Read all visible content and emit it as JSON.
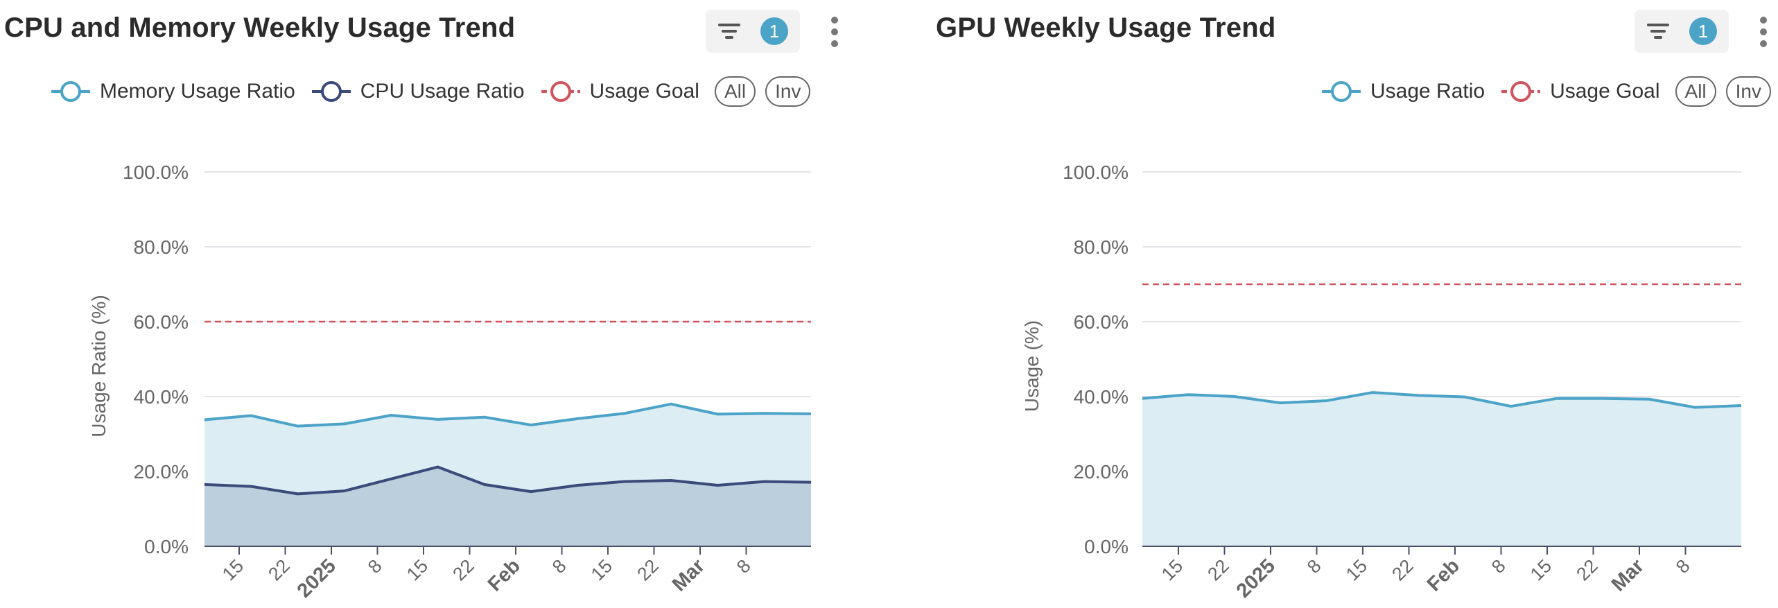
{
  "panels": [
    {
      "title": "CPU and Memory Weekly Usage Trend",
      "filter_badge": "1",
      "legend": [
        {
          "label": "Memory Usage Ratio",
          "color": "#4ba3c7",
          "icon": "circle-line-marker"
        },
        {
          "label": "CPU Usage Ratio",
          "color": "#3a4a7a",
          "icon": "circle-line-marker"
        },
        {
          "label": "Usage Goal",
          "color": "#d0545e",
          "icon": "circle-dashed-line-marker"
        }
      ],
      "buttons": {
        "all": "All",
        "inv": "Inv"
      }
    },
    {
      "title": "GPU Weekly Usage Trend",
      "filter_badge": "1",
      "legend": [
        {
          "label": "Usage Ratio",
          "color": "#4ba3c7",
          "icon": "circle-line-marker"
        },
        {
          "label": "Usage Goal",
          "color": "#d0545e",
          "icon": "circle-dashed-line-marker"
        }
      ],
      "buttons": {
        "all": "All",
        "inv": "Inv"
      }
    }
  ],
  "chart_data": [
    {
      "type": "area",
      "ylabel": "Usage Ratio (%)",
      "ylim": [
        0,
        100
      ],
      "yticks": [
        "0.0%",
        "20.0%",
        "40.0%",
        "60.0%",
        "80.0%",
        "100.0%"
      ],
      "xticks": [
        {
          "label": "15",
          "bold": false
        },
        {
          "label": "22",
          "bold": false
        },
        {
          "label": "2025",
          "bold": true
        },
        {
          "label": "8",
          "bold": false
        },
        {
          "label": "15",
          "bold": false
        },
        {
          "label": "22",
          "bold": false
        },
        {
          "label": "Feb",
          "bold": true
        },
        {
          "label": "8",
          "bold": false
        },
        {
          "label": "15",
          "bold": false
        },
        {
          "label": "22",
          "bold": false
        },
        {
          "label": "Mar",
          "bold": true
        },
        {
          "label": "8",
          "bold": false
        }
      ],
      "x": [
        "2024-12-10",
        "2024-12-17",
        "2024-12-24",
        "2024-12-31",
        "2025-01-07",
        "2025-01-14",
        "2025-01-21",
        "2025-01-28",
        "2025-02-04",
        "2025-02-11",
        "2025-02-18",
        "2025-02-25",
        "2025-03-04",
        "2025-03-11"
      ],
      "series": [
        {
          "name": "Memory Usage Ratio",
          "color": "#4ba3c7",
          "fill": "#dcedf4",
          "values": [
            33.8,
            34.9,
            32.1,
            32.7,
            35.0,
            33.9,
            34.5,
            32.4,
            34.1,
            35.5,
            38.0,
            35.3,
            35.5,
            35.4
          ]
        },
        {
          "name": "CPU Usage Ratio",
          "color": "#3a4a7a",
          "fill": "#bccfdc",
          "values": [
            16.5,
            16.0,
            14.0,
            14.8,
            18.0,
            21.2,
            16.5,
            14.6,
            16.3,
            17.3,
            17.6,
            16.3,
            17.3,
            17.1
          ]
        }
      ],
      "goal": {
        "name": "Usage Goal",
        "value": 60,
        "color": "#d0545e"
      },
      "grid": true
    },
    {
      "type": "area",
      "ylabel": "Usage (%)",
      "ylim": [
        0,
        100
      ],
      "yticks": [
        "0.0%",
        "20.0%",
        "40.0%",
        "60.0%",
        "80.0%",
        "100.0%"
      ],
      "xticks": [
        {
          "label": "15",
          "bold": false
        },
        {
          "label": "22",
          "bold": false
        },
        {
          "label": "2025",
          "bold": true
        },
        {
          "label": "8",
          "bold": false
        },
        {
          "label": "15",
          "bold": false
        },
        {
          "label": "22",
          "bold": false
        },
        {
          "label": "Feb",
          "bold": true
        },
        {
          "label": "8",
          "bold": false
        },
        {
          "label": "15",
          "bold": false
        },
        {
          "label": "22",
          "bold": false
        },
        {
          "label": "Mar",
          "bold": true
        },
        {
          "label": "8",
          "bold": false
        }
      ],
      "x": [
        "2024-12-10",
        "2024-12-17",
        "2024-12-24",
        "2024-12-31",
        "2025-01-07",
        "2025-01-14",
        "2025-01-21",
        "2025-01-28",
        "2025-02-04",
        "2025-02-11",
        "2025-02-18",
        "2025-02-25",
        "2025-03-04",
        "2025-03-11"
      ],
      "series": [
        {
          "name": "Usage Ratio",
          "color": "#4ba3c7",
          "fill": "#dcedf4",
          "values": [
            39.5,
            40.5,
            40.0,
            38.3,
            38.9,
            41.1,
            40.3,
            39.9,
            37.4,
            39.5,
            39.5,
            39.3,
            37.1,
            37.6
          ]
        }
      ],
      "goal": {
        "name": "Usage Goal",
        "value": 70,
        "color": "#d0545e"
      },
      "grid": true
    }
  ]
}
